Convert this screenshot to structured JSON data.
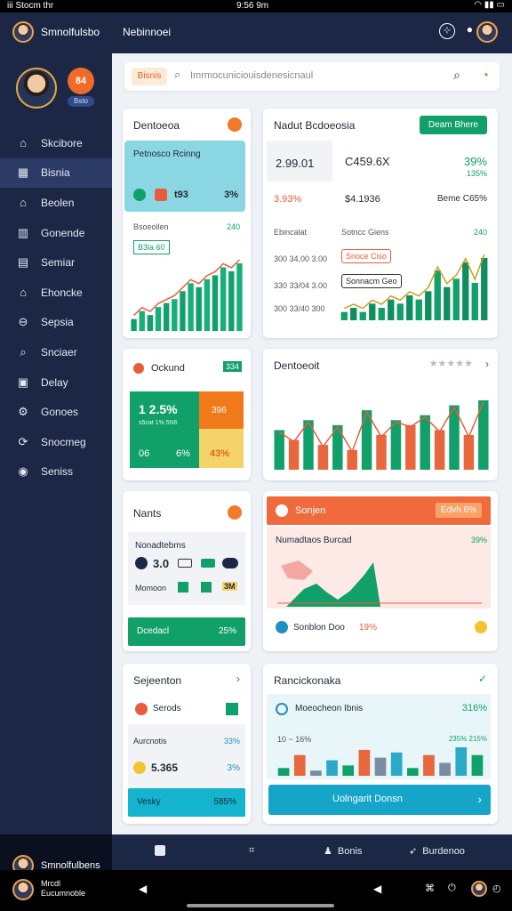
{
  "status": {
    "left": "iii Stocm thr",
    "center": "9:56 9m",
    "right": "◠ ▮▮ ▭"
  },
  "brand": {
    "name": "Smnolfulsbo",
    "topbar_title": "Nebinnoei"
  },
  "profile": {
    "badge": "84",
    "tag": "Bsto"
  },
  "nav": [
    {
      "label": "Skcibore",
      "icon": "home-icon",
      "glyph": "⌂"
    },
    {
      "label": "Bisnia",
      "icon": "grid-icon",
      "glyph": "▦"
    },
    {
      "label": "Beolen",
      "icon": "building-icon",
      "glyph": "⌂"
    },
    {
      "label": "Gonende",
      "icon": "chart-icon",
      "glyph": "▥"
    },
    {
      "label": "Semiar",
      "icon": "document-icon",
      "glyph": "▤"
    },
    {
      "label": "Ehoncke",
      "icon": "house-icon",
      "glyph": "⌂"
    },
    {
      "label": "Sepsia",
      "icon": "link-icon",
      "glyph": "⊖"
    },
    {
      "label": "Snciaer",
      "icon": "search-icon",
      "glyph": "⌕"
    },
    {
      "label": "Delay",
      "icon": "calendar-icon",
      "glyph": "▣"
    },
    {
      "label": "Gonoes",
      "icon": "gear-icon",
      "glyph": "⚙"
    },
    {
      "label": "Snocmeg",
      "icon": "refresh-icon",
      "glyph": "⟳"
    },
    {
      "label": "Seniss",
      "icon": "user-badge-icon",
      "glyph": "◉"
    }
  ],
  "sidebar_footer": "Smnolfulbens",
  "search": {
    "pill": "Bisnis",
    "placeholder": "Imrmocuniciouisdenesicnaul"
  },
  "cards": {
    "c1": {
      "title": "Dentoeoa",
      "inner_title": "Petnosco Rcinng",
      "values": [
        "t93",
        "3%"
      ],
      "sub1": "Bsoeollen",
      "sub2": "240",
      "tag": "B3la 60"
    },
    "c2": {
      "title": "Nadut Bcdoeosia",
      "button": "Deam Bhere",
      "v1": "2.99.01",
      "v2": "C459.6X",
      "v3": "39%",
      "v4": "135%",
      "v5": "3.93%",
      "v6": "$4.1936",
      "v7": "Beme C65%",
      "sub": "Ebincalat",
      "sub2": "Sotncc Giens",
      "sub3": "240",
      "b1": "Snoce Ciso",
      "b2": "Sonnacm Geo",
      "axis": [
        "300 34,00 3.00",
        "330 33/04 3.00",
        "300 33/40 300"
      ]
    },
    "c3": {
      "title": "Ockund",
      "b": "334",
      "v1": "1 2.5%",
      "v1s": "s5cat 1% 5N6",
      "v2": "396",
      "v3": "06",
      "v4": "6%",
      "v5": "43%"
    },
    "c4": {
      "title": "Dentoeoit"
    },
    "c5": {
      "title": "Nants",
      "sub": "Nonadtebms",
      "v": "3.0",
      "m": "Momoon",
      "m2": "3M",
      "btn": "Dcedacl",
      "pct": "25%"
    },
    "c6": {
      "title": "Sonjen",
      "tag": "Edvh 6%",
      "inner": "Numadtaos Burcad",
      "pct": "39%",
      "foot": "Sonblon Doo",
      "foot2": "19%"
    },
    "c7": {
      "title": "Sejeenton",
      "r1": "Serods",
      "r2": "Aurcnotis",
      "r2v": "33%",
      "v": "5.365",
      "v2": "3%",
      "btn": "Vesky",
      "btnv": "585%"
    },
    "c8": {
      "title": "Rancickonaka",
      "inner": "Moeocheon Ibnis",
      "pct": "316%",
      "sub": "10 ~ 16%",
      "sub2": "235% 215%",
      "btn": "Uolngarit Donsn"
    }
  },
  "bottombar": {
    "b1": "Bonis",
    "b2": "Burdenoo"
  },
  "sys": {
    "name1": "Mrcdl",
    "name2": "Eucumnoble"
  },
  "colors": {
    "green": "#12a06a",
    "orange": "#f06a2a",
    "teal": "#8ad6e3",
    "navy": "#1c2746",
    "red": "#e85c3c"
  },
  "chart_data": [
    {
      "type": "bar",
      "values": [
        3,
        5,
        4,
        6,
        7,
        8,
        10,
        12,
        11,
        13,
        14,
        16,
        15,
        17
      ],
      "title": "Dentoeoa"
    },
    {
      "type": "bar",
      "values": [
        2,
        3,
        2,
        4,
        3,
        5,
        4,
        6,
        5,
        7,
        12,
        8,
        10,
        14,
        9,
        15
      ],
      "title": "Nadut Bcdoeosia"
    },
    {
      "type": "bar",
      "values": [
        8,
        6,
        10,
        5,
        9,
        4,
        12,
        7,
        10,
        9,
        11,
        8,
        13,
        7,
        14
      ],
      "title": "Dentoeoit"
    },
    {
      "type": "bar",
      "values": [
        3,
        8,
        2,
        6,
        4,
        10,
        7,
        9,
        3,
        8,
        5,
        11,
        8
      ],
      "title": "Rancickonaka"
    }
  ]
}
